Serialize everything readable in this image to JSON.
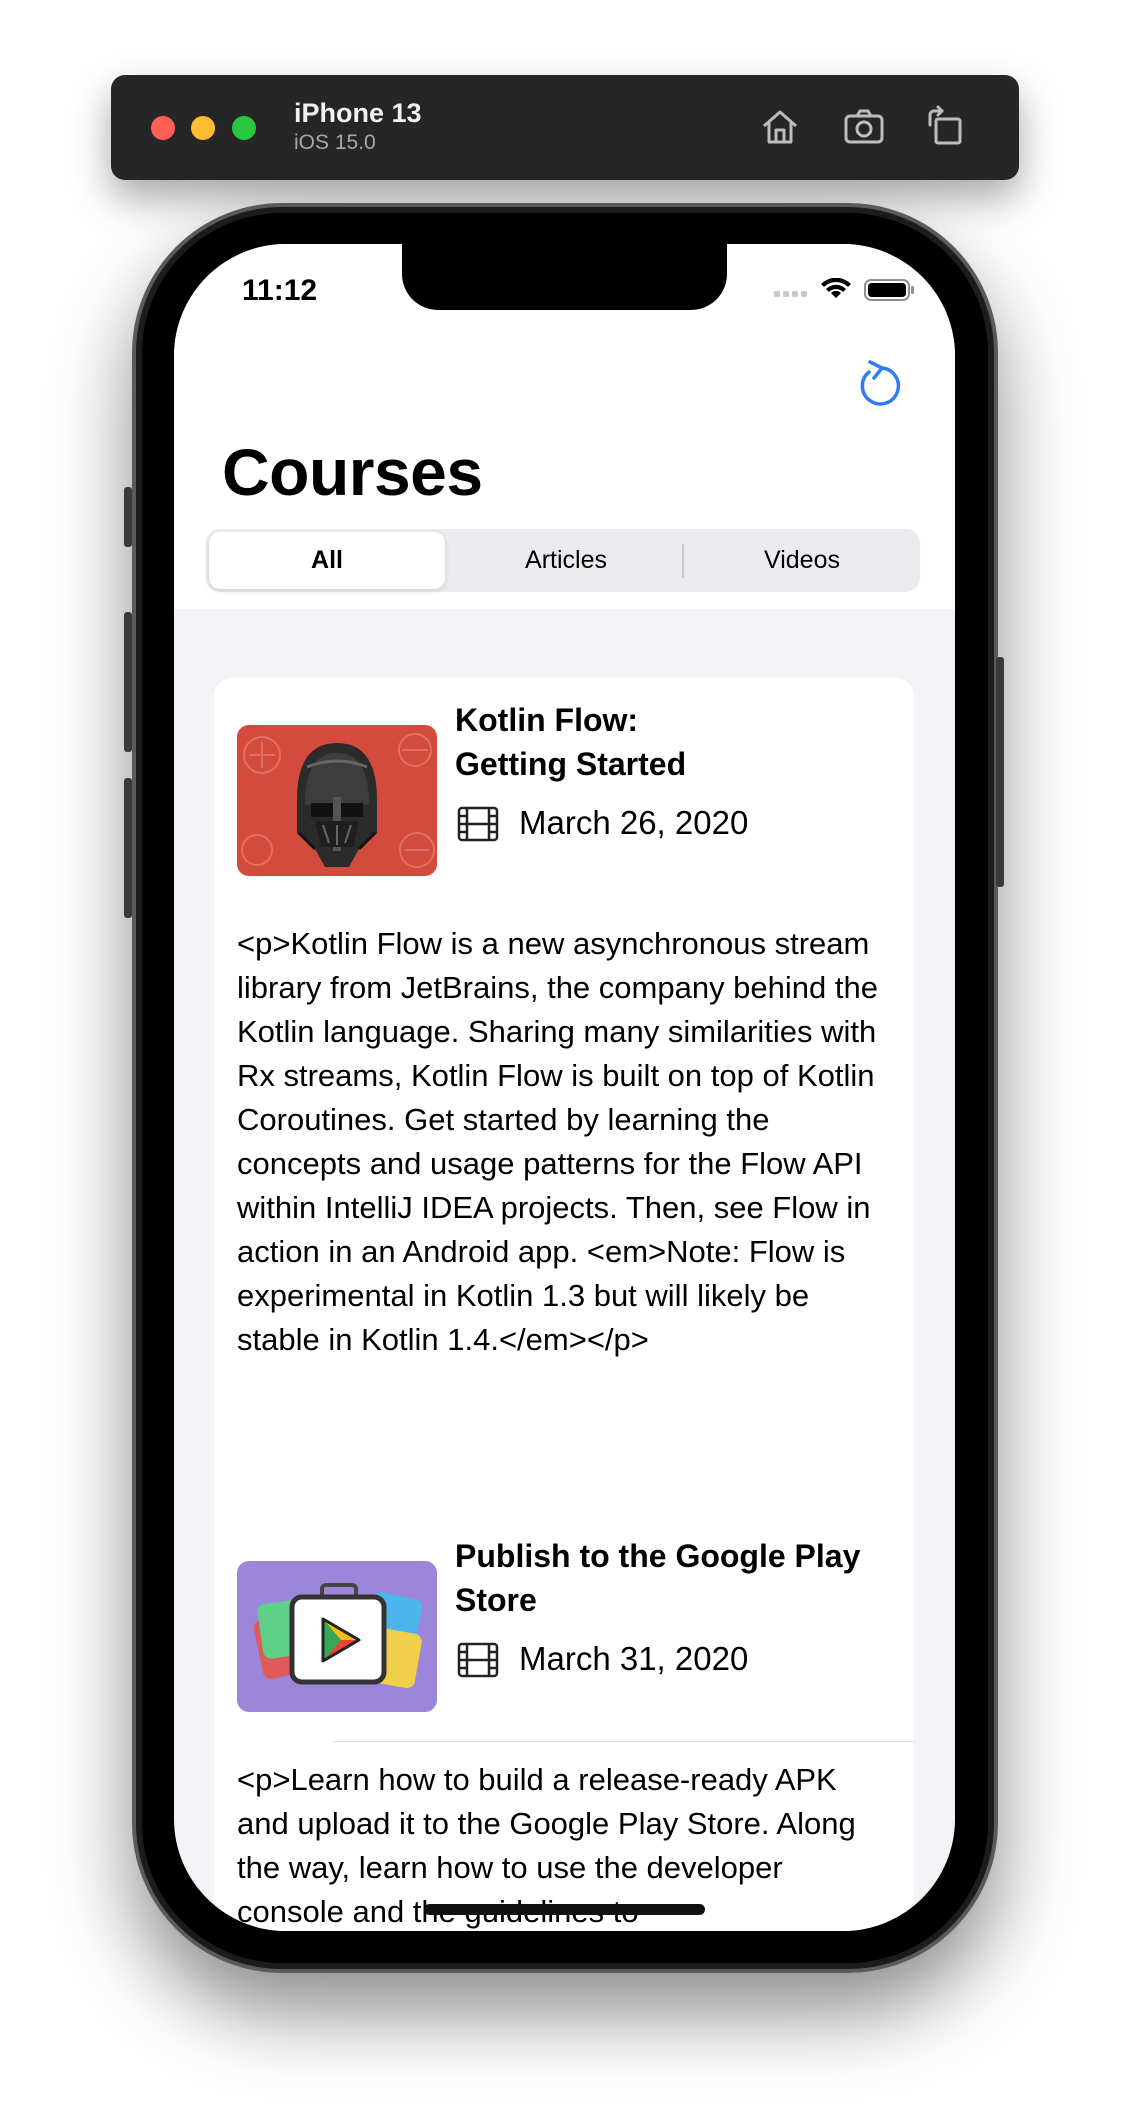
{
  "simulator": {
    "device_name": "iPhone 13",
    "os_version": "iOS 15.0",
    "icons": [
      "home-icon",
      "screenshot-icon",
      "rotate-icon"
    ]
  },
  "status_bar": {
    "time": "11:12",
    "icons": [
      "signal-icon",
      "wifi-icon",
      "battery-icon"
    ]
  },
  "nav": {
    "title": "Courses",
    "refresh_icon": "refresh-icon"
  },
  "filter": {
    "segments": [
      "All",
      "Articles",
      "Videos"
    ],
    "selected": "All"
  },
  "courses": [
    {
      "title": "Kotlin Flow:\nGetting Started",
      "date": "March 26, 2020",
      "media_icon": "film-icon",
      "thumbnail": "kotlin-flow-artwork",
      "thumbnail_color": "#d24b3c",
      "description": "<p>Kotlin Flow is a new asynchronous stream library from JetBrains, the company behind the Kotlin language. Sharing many similarities with Rx streams, Kotlin Flow is built on top of Kotlin Coroutines. Get started by learning the concepts and usage patterns for the Flow API within IntelliJ IDEA projects. Then, see Flow in action in an Android app. <em>Note: Flow is experimental in Kotlin 1.3 but will likely be stable in Kotlin 1.4.</em></p>"
    },
    {
      "title": "Publish to the Google Play Store",
      "date": "March 31, 2020",
      "media_icon": "film-icon",
      "thumbnail": "play-store-artwork",
      "thumbnail_color": "#9b86d9",
      "description": "<p>Learn how to build a release-ready APK and upload it to the Google Play Store. Along the way, learn how to use the developer console and the guidelines to"
    }
  ],
  "colors": {
    "accent": "#2f7cf6",
    "background": "#f2f2f7",
    "card": "#ffffff"
  }
}
